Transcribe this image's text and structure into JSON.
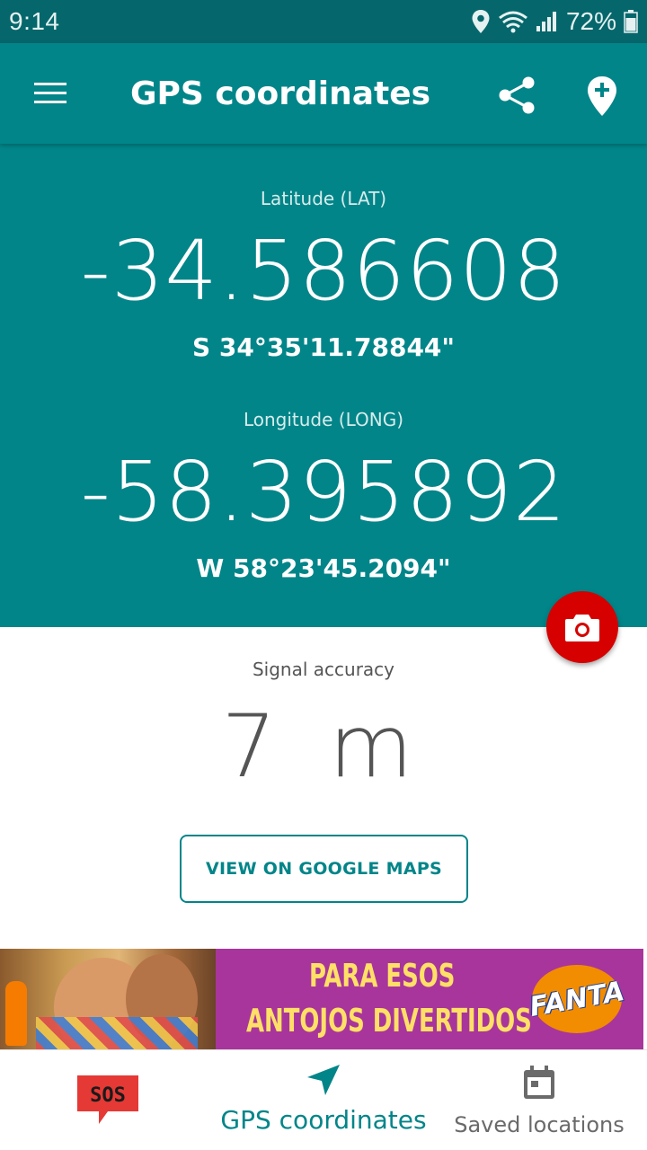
{
  "status_bar": {
    "time": "9:14",
    "battery": "72%"
  },
  "app_bar": {
    "title": "GPS coordinates",
    "icons": [
      "menu-icon",
      "share-icon",
      "add-location-icon"
    ]
  },
  "coordinates": {
    "latitude_label": "Latitude (LAT)",
    "latitude_value": "-34.586608",
    "latitude_dms": "S 34°35'11.78844\"",
    "longitude_label": "Longitude (LONG)",
    "longitude_value": "-58.395892",
    "longitude_dms": "W 58°23'45.2094\""
  },
  "accuracy": {
    "label": "Signal accuracy",
    "value": "7 m"
  },
  "actions": {
    "maps_button": "VIEW ON GOOGLE MAPS",
    "camera_fab_icon": "camera-icon"
  },
  "ad": {
    "line1": "PARA ESOS",
    "line2": "ANTOJOS DIVERTIDOS",
    "brand": "FANTA"
  },
  "bottom_nav": {
    "sos_label": "SOS",
    "gps_label": "GPS coordinates",
    "saved_label": "Saved locations"
  },
  "colors": {
    "primary": "#018589",
    "status_bar": "#05676b",
    "fab": "#d60000",
    "sos": "#e53935"
  }
}
